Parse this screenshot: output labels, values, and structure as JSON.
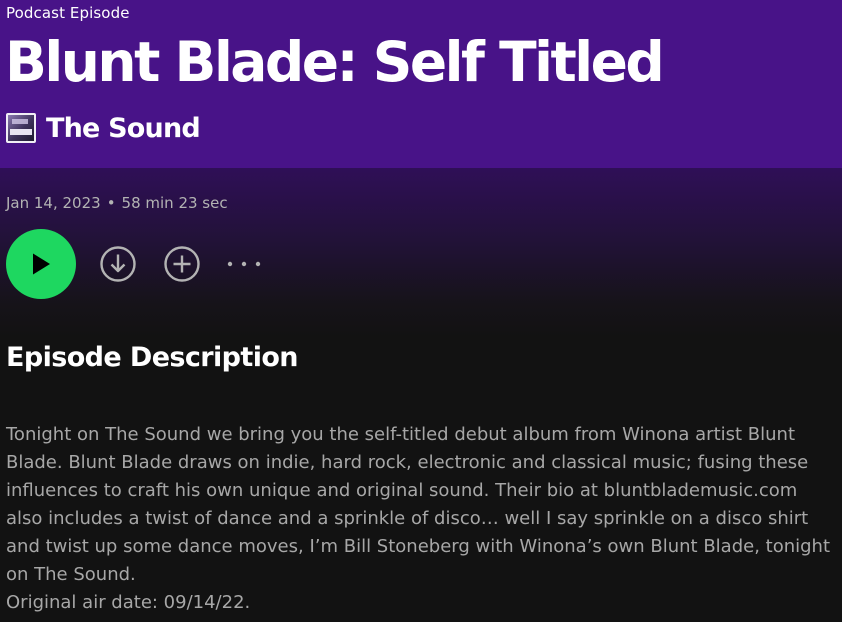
{
  "header": {
    "episode_type": "Podcast Episode",
    "title": "Blunt Blade: Self Titled",
    "show_name": "The Sound",
    "background_color": "#481388"
  },
  "meta": {
    "date": "Jan 14, 2023",
    "separator": "•",
    "duration": "58 min 23 sec"
  },
  "controls": {
    "play_icon": "play-icon",
    "download_icon": "download-icon",
    "add_icon": "add-circle-icon",
    "more_icon": "more-horizontal-icon",
    "accent_color": "#1ed760"
  },
  "description": {
    "heading": "Episode Description",
    "body": "Tonight on The Sound we bring you the self-titled debut album from Winona artist Blunt Blade. Blunt Blade draws on indie, hard rock, electronic and classical music; fusing these influences to craft his own unique and original sound. Their bio at bluntblademusic.com also includes a twist of dance and a sprinkle of disco… well I say sprinkle on a disco shirt and twist up some dance moves, I’m Bill Stoneberg with Winona’s own Blunt Blade, tonight on The Sound.",
    "air_date": "Original air date: 09/14/22."
  }
}
